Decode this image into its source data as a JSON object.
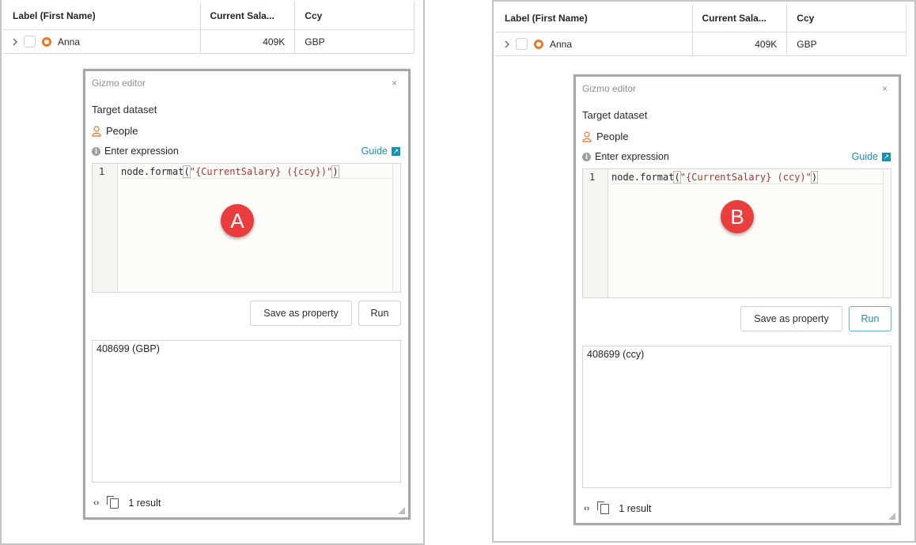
{
  "table": {
    "columns": [
      "Label (First Name)",
      "Current Sala...",
      "Ccy"
    ],
    "row": {
      "name": "Anna",
      "salary": "409K",
      "ccy": "GBP"
    }
  },
  "editor": {
    "title": "Gizmo editor",
    "close": "×",
    "target_label": "Target dataset",
    "dataset": "People",
    "enter_label": "Enter expression",
    "guide": "Guide",
    "line_number": "1",
    "save_button": "Save as property",
    "run_button": "Run",
    "result_count": "1 result",
    "footer_code_icon": "‹›"
  },
  "panels": [
    {
      "marker": "A",
      "code": {
        "prefix": "node.format",
        "open": "(",
        "string": "\"{CurrentSalary} ({ccy})\"",
        "close": ")"
      },
      "output": "408699 (GBP)",
      "run_active": false
    },
    {
      "marker": "B",
      "code": {
        "prefix": "node.format",
        "open": "(",
        "string": "\"{CurrentSalary} (ccy)\"",
        "close": ")"
      },
      "output": "408699 (ccy)",
      "run_active": true
    }
  ],
  "colors": {
    "marker": "#e83e3e",
    "accent": "#1a8fb0",
    "node": "#e8782a"
  },
  "icons": [
    "chevron-right-icon",
    "checkbox-icon",
    "node-icon",
    "person-icon",
    "info-icon",
    "external-link-icon",
    "code-icon",
    "copy-icon",
    "resize-grip-icon"
  ]
}
